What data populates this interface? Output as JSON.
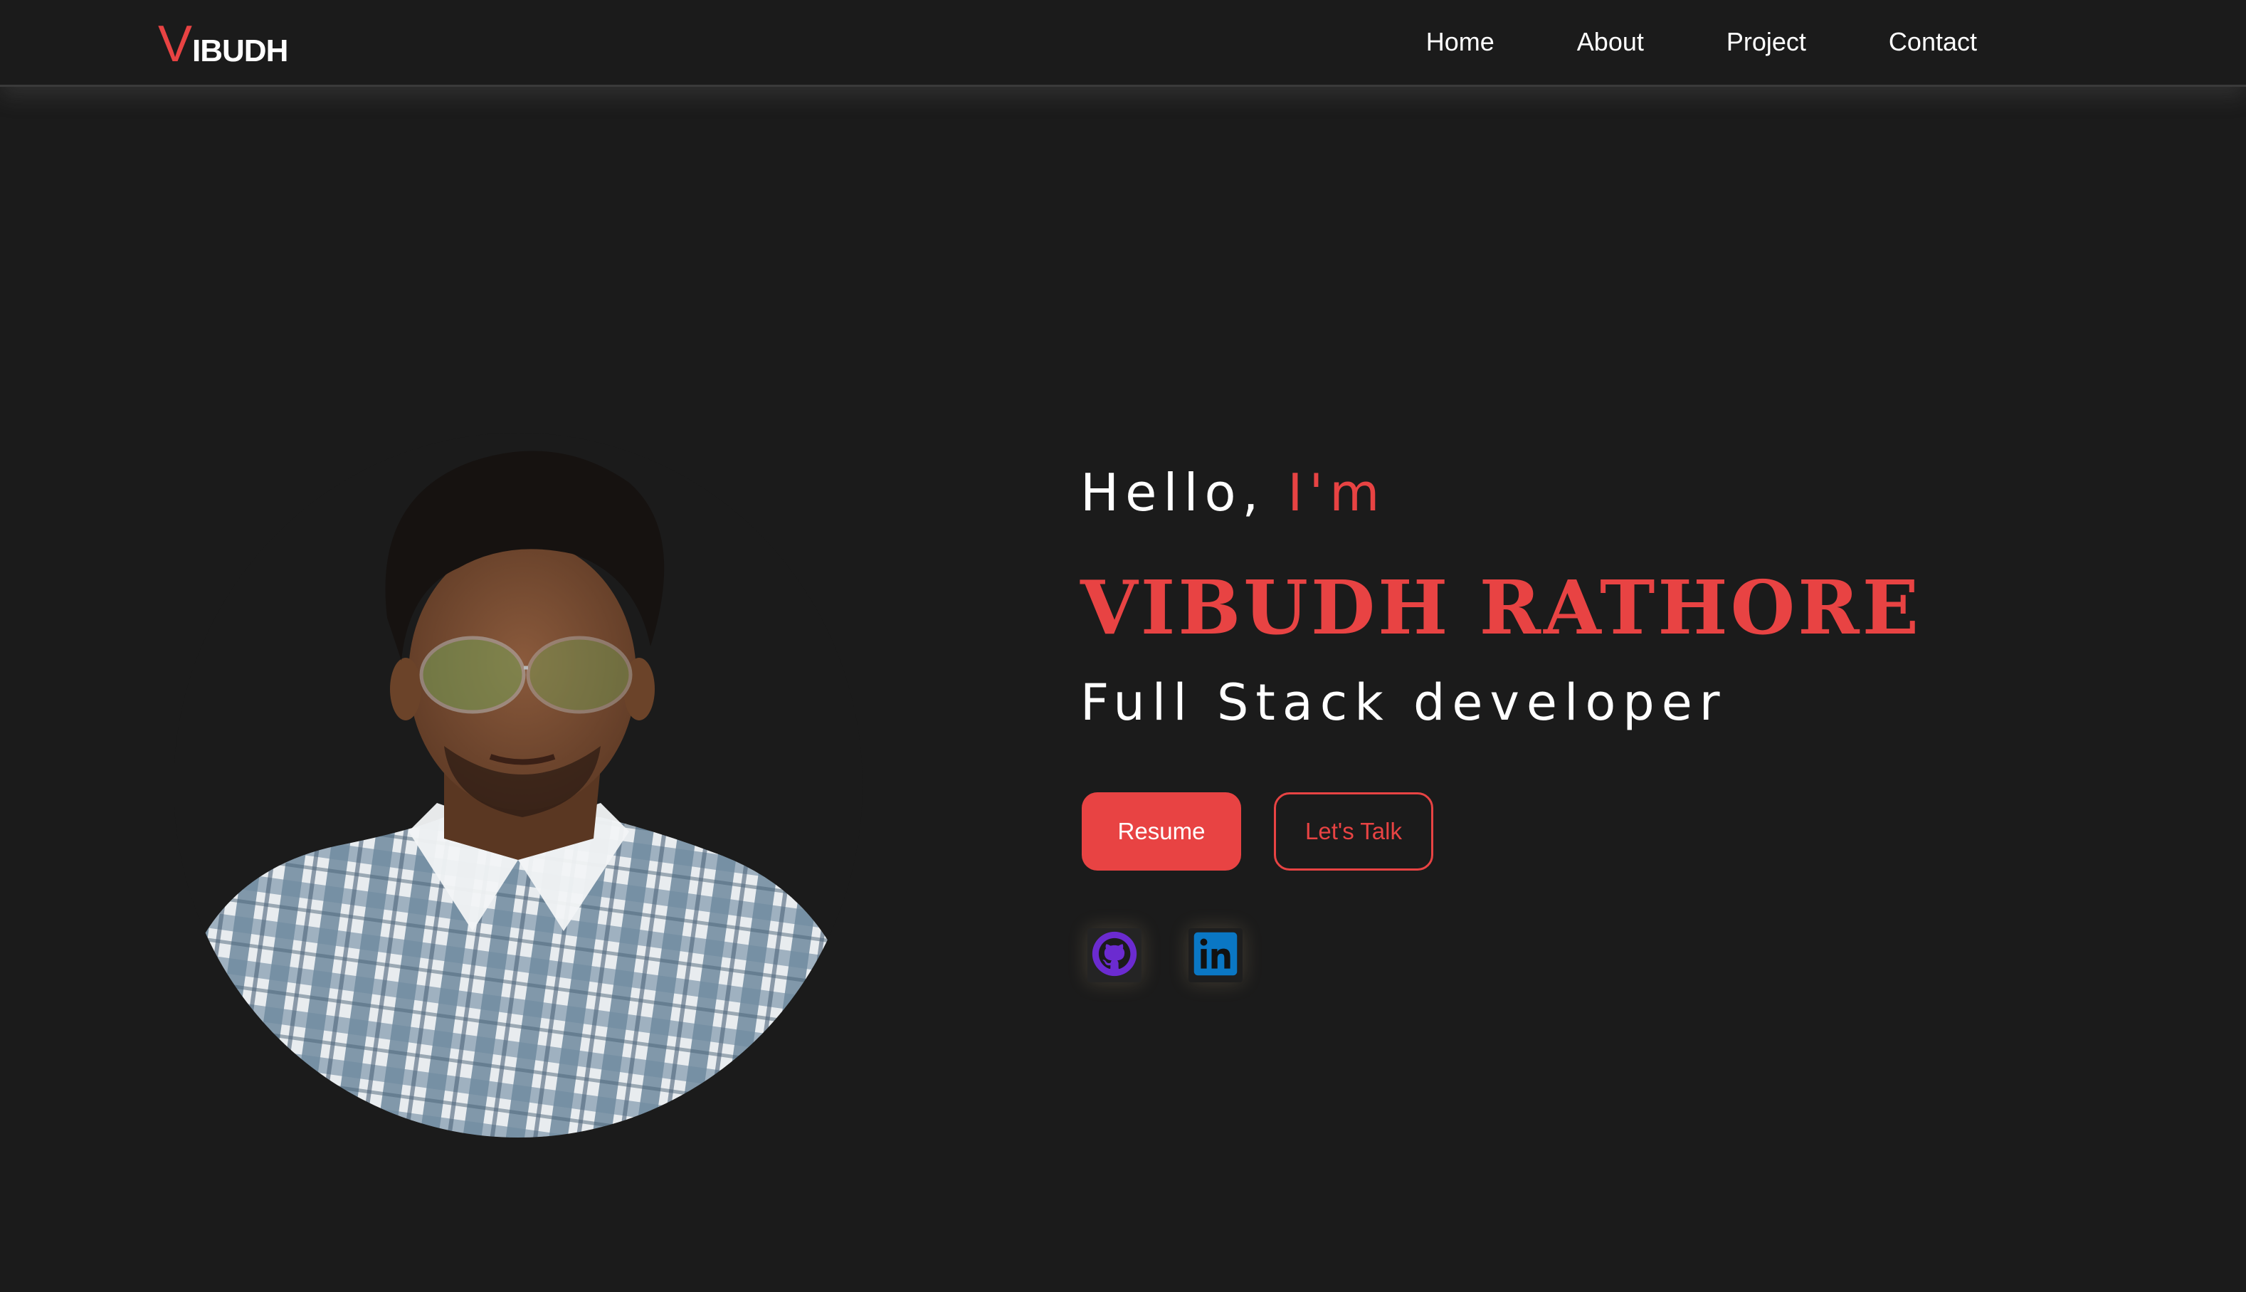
{
  "brand": {
    "logo_initial": "V",
    "logo_rest": "IBUDH",
    "accent_color": "#e84343",
    "background_color": "#1b1b1b"
  },
  "nav": {
    "items": [
      {
        "label": "Home"
      },
      {
        "label": "About"
      },
      {
        "label": "Project"
      },
      {
        "label": "Contact"
      }
    ]
  },
  "hero": {
    "greeting": "Hello, ",
    "greeting_accent": "I'm",
    "name": "VIBUDH RATHORE",
    "role": "Full Stack developer",
    "primary_button": "Resume",
    "secondary_button": "Let's Talk",
    "portrait_alt": "profile-photo"
  },
  "social": [
    {
      "icon": "github-icon"
    },
    {
      "icon": "linkedin-icon"
    }
  ]
}
